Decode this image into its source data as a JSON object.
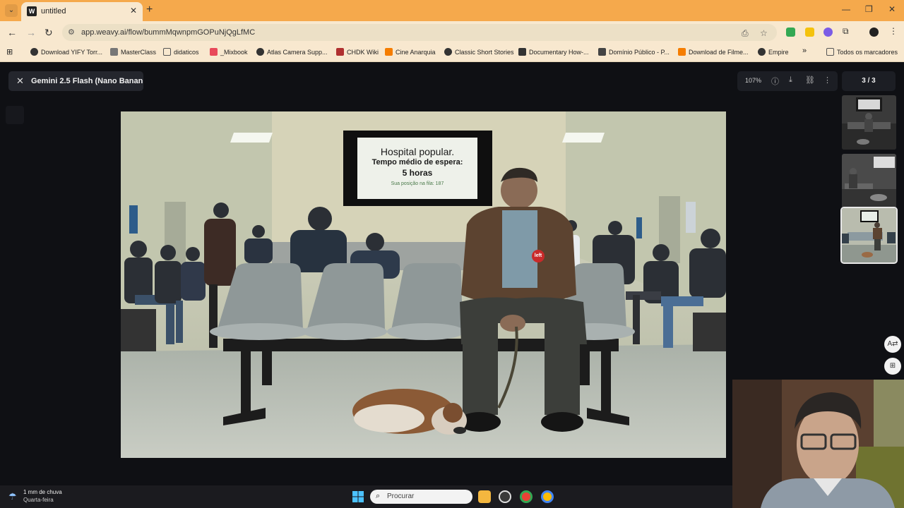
{
  "browser": {
    "tab_title": "untitled",
    "tab_favicon": "W",
    "url": "app.weavy.ai/flow/bummMqwnpmGOPuNjQgLfMC",
    "bookmarks": [
      {
        "label": "Download YIFY Torr...",
        "icon": "globe-icon",
        "color": "#333333"
      },
      {
        "label": "MasterClass",
        "icon": "masterclass-icon",
        "color": "#555555"
      },
      {
        "label": "didaticos",
        "icon": "folder-icon",
        "color": "#555555"
      },
      {
        "label": "_Mixbook",
        "icon": "mixbook-icon",
        "color": "#e8495a"
      },
      {
        "label": "Atlas Camera Supp...",
        "icon": "globe-icon",
        "color": "#333333"
      },
      {
        "label": "CHDK Wiki",
        "icon": "chdk-icon",
        "color": "#b03030"
      },
      {
        "label": "Cine Anarquia",
        "icon": "blogger-icon",
        "color": "#f57d00"
      },
      {
        "label": "Classic Short Stories",
        "icon": "globe-icon",
        "color": "#333333"
      },
      {
        "label": "Documentary How-...",
        "icon": "doc-icon",
        "color": "#333333"
      },
      {
        "label": "Domínio Público - P...",
        "icon": "dominio-icon",
        "color": "#444444"
      },
      {
        "label": "Download de Filme...",
        "icon": "blogger-icon",
        "color": "#f57d00"
      },
      {
        "label": "Empire",
        "icon": "globe-icon",
        "color": "#333333"
      }
    ],
    "more_bookmarks": "»",
    "all_bookmarks": "Todos os marcadores"
  },
  "app": {
    "generation_title": "Gemini 2.5 Flash (Nano Banan...",
    "zoom": "107%",
    "counter": "3 / 3"
  },
  "image": {
    "tv_line1": "Hospital popular.",
    "tv_line2": "Tempo médio de espera:",
    "tv_line3": "5 horas",
    "tv_line4": "Sua posição na fila: 187",
    "badge": "left"
  },
  "taskbar": {
    "weather_line1": "1 mm de chuva",
    "weather_line2": "Quarta-feira",
    "search_placeholder": "Procurar"
  },
  "colors": {
    "tab_strip": "#f5a94c",
    "toolbar": "#f8e8cf",
    "app_bg": "#0f1014"
  }
}
